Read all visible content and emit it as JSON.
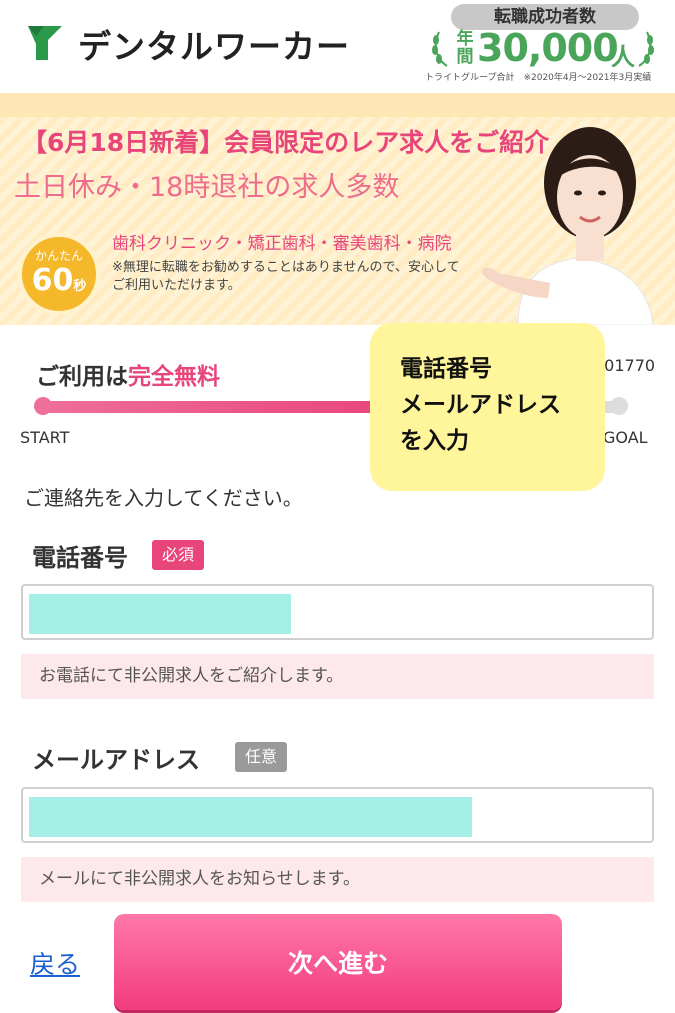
{
  "header": {
    "logo_text": "デンタルワーカー",
    "award": {
      "pill": "転職成功者数",
      "prefix": "年間",
      "count": "30,000",
      "unit": "人",
      "note": "トライトグループ合計　※2020年4月〜2021年3月実績"
    }
  },
  "banner": {
    "headline": "【6月18日新着】会員限定のレア求人をご紹介",
    "sub": "土日休み・18時退社の求人多数",
    "badge_top": "かんたん",
    "badge_num": "60",
    "badge_sec": "秒",
    "categories": "歯科クリニック・矯正歯科・審美歯科・病院",
    "note": "※無理に転職をお勧めすることはありませんので、安心してご利用いただけます。"
  },
  "progress": {
    "free_prefix": "ご利用は",
    "free_emphasis": "完全無料",
    "ref_no": "301770",
    "start_label": "START",
    "goal_label": "GOAL",
    "fill_fraction": 0.6
  },
  "sticky_note": {
    "lines": [
      "電話番号",
      "メールアドレス",
      "を入力"
    ]
  },
  "form": {
    "instruction": "ご連絡先を入力してください。",
    "phone": {
      "label": "電話番号",
      "tag": "必須",
      "helper": "お電話にて非公開求人をご紹介します。"
    },
    "email": {
      "label": "メールアドレス",
      "tag": "任意",
      "helper": "メールにて非公開求人をお知らせします。"
    }
  },
  "footer": {
    "back_label": "戻る",
    "next_label": "次へ進む"
  },
  "colors": {
    "brand_pink": "#e8467a",
    "brand_green": "#4aa55a",
    "redaction": "#a4f0e6",
    "sticky": "#fff59a"
  }
}
